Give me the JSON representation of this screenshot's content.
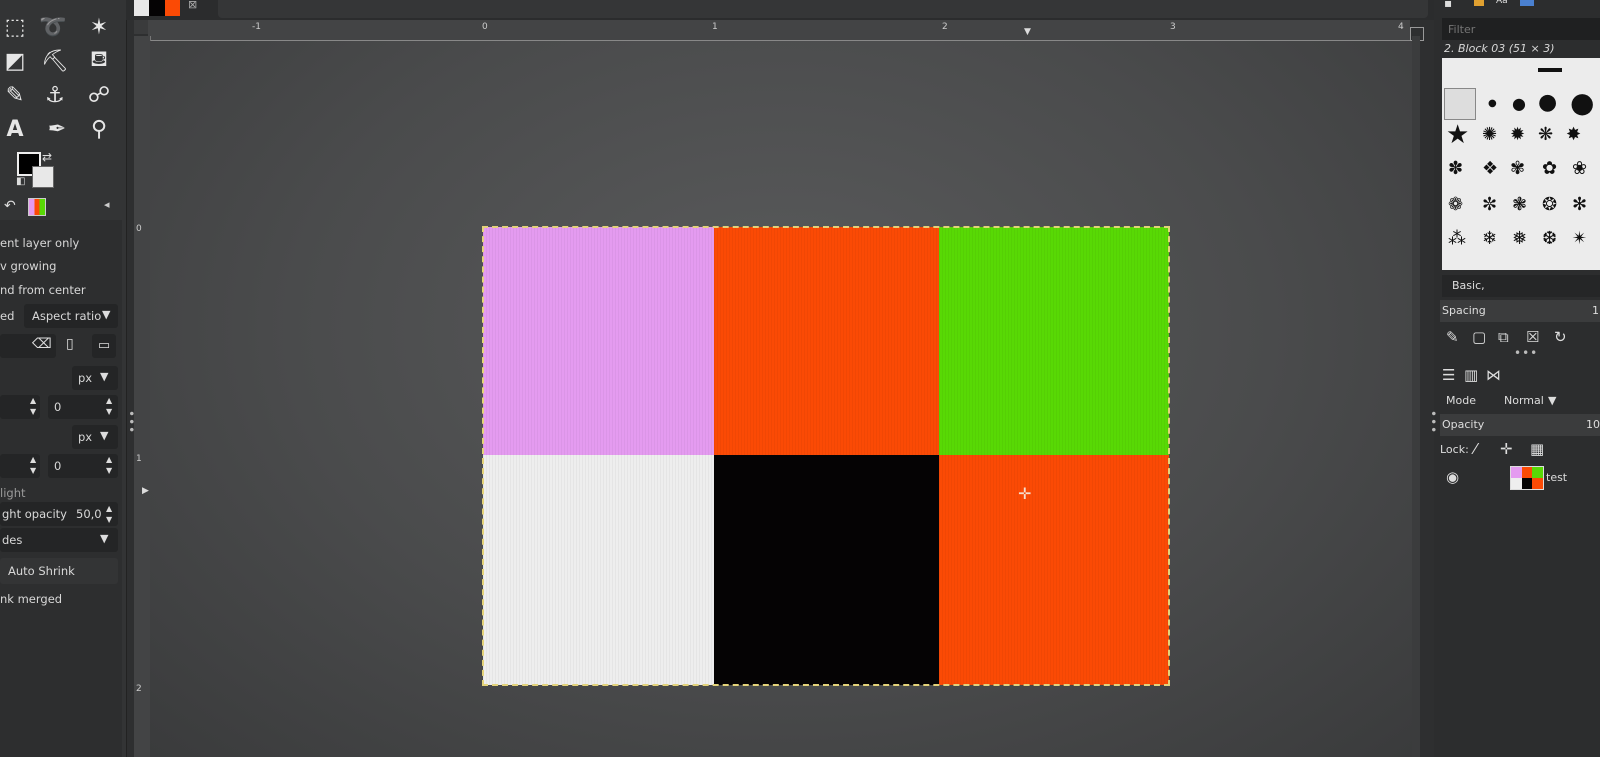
{
  "tool_options": {
    "current_layer_only": "ent layer only",
    "allow_growing": "v growing",
    "expand_from_center": "nd from center",
    "fixed_label": "ed",
    "aspect_ratio": "Aspect ratio",
    "unit_1": "px",
    "position_x": "0",
    "unit_2": "px",
    "position_y": "0",
    "highlight": "light",
    "highlight_opacity_label": "ght opacity",
    "highlight_opacity_value": "50,0",
    "guides": "des",
    "auto_shrink": "Auto Shrink",
    "shrink_merged": "nk merged"
  },
  "rulers": {
    "h_labels": [
      "-1",
      "0",
      "1",
      "2",
      "3",
      "4"
    ],
    "v_labels": [
      "0",
      "1",
      "2"
    ]
  },
  "canvas": {
    "cells": [
      "#e49bf0",
      "#fb4a05",
      "#58d905",
      "#eeeeee",
      "#050304",
      "#fb4a05"
    ]
  },
  "right_dock": {
    "filter_placeholder": "Filter",
    "brush_name": "2. Block 03 (51 × 3)",
    "brush_tag": "Basic,",
    "spacing_label": "Spacing",
    "spacing_value": "1",
    "mode_label": "Mode",
    "mode_value": "Normal",
    "opacity_label": "Opacity",
    "opacity_value": "10",
    "lock_label": "Lock:",
    "layer_name": "test"
  },
  "colors": {
    "fg": "#000000",
    "bg": "#e8e8e8",
    "selection_outline": "#e3d27a"
  },
  "icons": {
    "tools": [
      "rect-select-icon",
      "lasso-icon",
      "fuzzy-select-icon",
      "transform-icon",
      "warp-icon",
      "bucket-fill-icon",
      "eraser-icon",
      "clone-icon",
      "smudge-icon",
      "text-icon",
      "color-picker-icon",
      "zoom-icon"
    ]
  }
}
